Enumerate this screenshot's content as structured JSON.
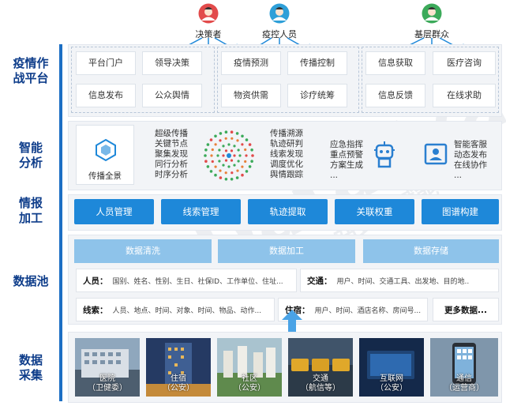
{
  "users": [
    {
      "label": "决策者",
      "icon": "user-decision-maker-icon",
      "color": "#e24b4b"
    },
    {
      "label": "疫控人员",
      "icon": "user-epidemic-staff-icon",
      "color": "#2e9fd8"
    },
    {
      "label": "基层群众",
      "icon": "user-public-icon",
      "color": "#3caa5a"
    }
  ],
  "rows": {
    "platform": "疫情作战平台",
    "analysis": "智能分析",
    "processing": "情报加工",
    "pool": "数据池",
    "collect": "数据采集"
  },
  "platform": {
    "cells": [
      "平台门户",
      "领导决策",
      "疫情预测",
      "传播控制",
      "信息获取",
      "医疗咨询",
      "信息发布",
      "公众舆情",
      "物资供需",
      "诊疗统筹",
      "信息反馈",
      "在线求助"
    ]
  },
  "analysis": {
    "propagation_label": "传播全景",
    "list1": [
      "超级传播",
      "关键节点",
      "聚集发现",
      "同行分析",
      "时序分析"
    ],
    "list2": [
      "传播溯源",
      "轨迹研判",
      "线索发现",
      "调度优化",
      "舆情跟踪"
    ],
    "list3": [
      "应急指挥",
      "重点预警",
      "方案生成",
      "..."
    ],
    "list4": [
      "智能客服",
      "动态发布",
      "在线协作",
      "..."
    ]
  },
  "processing": {
    "buttons": [
      "人员管理",
      "线索管理",
      "轨迹提取",
      "关联权重",
      "图谱构建"
    ]
  },
  "pool": {
    "steps": [
      "数据清洗",
      "数据加工",
      "数据存储"
    ],
    "items": [
      {
        "title": "人员：",
        "text": "国别、姓名、性别、生日、社保ID、工作单位、住址..."
      },
      {
        "title": "交通：",
        "text": "用户、时间、交通工具、出发地、目的地.."
      },
      {
        "title": "线索：",
        "text": "人员、地点、时间、对象、时间、物品、动作..."
      },
      {
        "title": "住宿：",
        "text": "用户、时间、酒店名称、房间号..."
      },
      {
        "title": "更多数据...",
        "text": ""
      }
    ]
  },
  "sources": [
    {
      "name": "医院",
      "sub": "（卫健委）"
    },
    {
      "name": "住宿",
      "sub": "（公安）"
    },
    {
      "name": "社区",
      "sub": "（公安）"
    },
    {
      "name": "交通",
      "sub": "（航信等）"
    },
    {
      "name": "互联网",
      "sub": "（公安）"
    },
    {
      "name": "通信",
      "sub": "（运营商）"
    }
  ],
  "watermark": {
    "brand": "DataExa",
    "slogan": "一站式AI赋能"
  },
  "colors": {
    "accent": "#1e88d9",
    "dark": "#0e3d8a",
    "light": "#8ec3ea"
  }
}
